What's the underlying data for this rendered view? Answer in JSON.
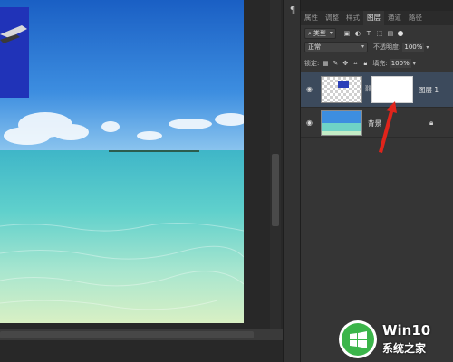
{
  "panel": {
    "tabs": [
      {
        "label": "属性"
      },
      {
        "label": "调整"
      },
      {
        "label": "样式"
      },
      {
        "label": "图层"
      },
      {
        "label": "通道"
      },
      {
        "label": "路径"
      }
    ],
    "active_tab": "图层",
    "filter_label": "类型",
    "blend_mode": "正常",
    "opacity_label": "不透明度:",
    "opacity_value": "100%",
    "lock_label": "锁定:",
    "fill_label": "填充:",
    "fill_value": "100%"
  },
  "layers": [
    {
      "name": "图层 1",
      "selected": true,
      "has_mask": true
    },
    {
      "name": "背景",
      "selected": false,
      "locked": true
    }
  ],
  "watermark": {
    "title": "Win10",
    "subtitle": "系统之家"
  },
  "colors": {
    "selected_layer": "#3c4a5c",
    "arrow": "#e0241b",
    "panel_bg": "#353535"
  }
}
